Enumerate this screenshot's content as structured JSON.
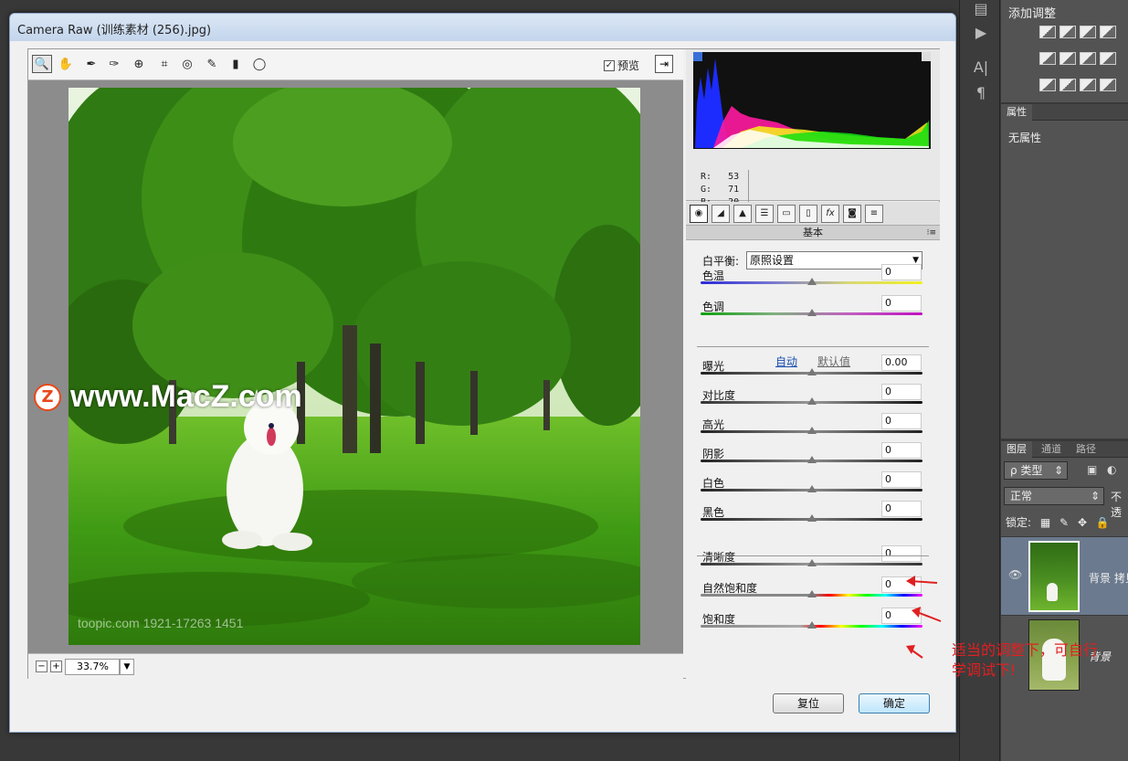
{
  "window": {
    "title": "Camera Raw (训练素材 (256).jpg)"
  },
  "toolbar": {
    "tools": [
      "zoom-tool",
      "hand-tool",
      "white-balance-tool",
      "color-sampler-tool",
      "targeted-adjustment-tool",
      "crop-tool",
      "straighten-tool",
      "spot-removal-tool",
      "red-eye-tool",
      "adjustment-brush",
      "graduated-filter",
      "radial-filter"
    ],
    "preview_label": "预览",
    "preview_checked": "✓"
  },
  "photo": {
    "watermark": "www.MacZ.com",
    "watermark_logo": "Z",
    "stock_mark": "toopic.com  1921-17263 1451"
  },
  "zoom": {
    "minus": "−",
    "plus": "+",
    "value": "33.7%",
    "dropdown": "▼"
  },
  "readout": {
    "r_label": "R:",
    "r": "53",
    "g_label": "G:",
    "g": "71",
    "b_label": "B:",
    "b": "20"
  },
  "panel": {
    "tabs": [
      "basic",
      "tone-curve",
      "detail",
      "hsl",
      "split-toning",
      "lens",
      "fx",
      "camera-calibration",
      "presets"
    ],
    "section_title": "基本",
    "white_balance_label": "白平衡:",
    "white_balance_value": "原照设置",
    "auto_label": "自动",
    "default_label": "默认值",
    "sliders": [
      {
        "label": "色温",
        "value": "0",
        "fill": "0.5"
      },
      {
        "label": "色调",
        "value": "0",
        "fill": "0.5"
      },
      {
        "label": "曝光",
        "value": "0.00",
        "fill": "0.5"
      },
      {
        "label": "对比度",
        "value": "0",
        "fill": "0.5"
      },
      {
        "label": "高光",
        "value": "0",
        "fill": "0.5"
      },
      {
        "label": "阴影",
        "value": "0",
        "fill": "0.5"
      },
      {
        "label": "白色",
        "value": "0",
        "fill": "0.5"
      },
      {
        "label": "黑色",
        "value": "0",
        "fill": "0.5"
      },
      {
        "label": "清晰度",
        "value": "0",
        "fill": "0.5"
      },
      {
        "label": "自然饱和度",
        "value": "0",
        "fill": "0.5"
      },
      {
        "label": "饱和度",
        "value": "0",
        "fill": "0.5"
      }
    ]
  },
  "buttons": {
    "reset": "复位",
    "ok": "确定"
  },
  "annotation": {
    "line1": "适当的调整下，可自行",
    "line2": "学调试下!"
  },
  "ps": {
    "adjustments_title": "添加调整",
    "properties_tab": "属性",
    "no_properties": "无属性",
    "layers_tab": "图层",
    "channels_tab": "通道",
    "paths_tab": "路径",
    "kind_filter": "ρ 类型",
    "blend_mode": "正常",
    "opacity_label": "不透",
    "lock_label": "锁定:",
    "layer1_name": "背景 拷贝",
    "layer2_name": "背景",
    "eye": "👁",
    "side_tools": [
      "A|",
      "¶"
    ]
  },
  "colors": {
    "accent": "#3c7fb1",
    "annotation": "#e02020"
  }
}
